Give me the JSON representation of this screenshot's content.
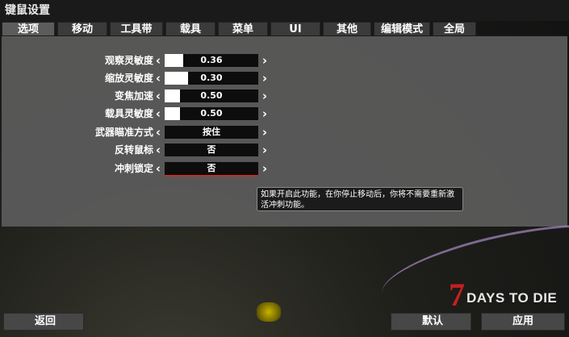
{
  "window": {
    "title": "键鼠设置"
  },
  "tabs": [
    {
      "label": "选项"
    },
    {
      "label": "移动"
    },
    {
      "label": "工具带"
    },
    {
      "label": "载具"
    },
    {
      "label": "菜单"
    },
    {
      "label": "UI"
    },
    {
      "label": "其他"
    },
    {
      "label": "编辑模式"
    },
    {
      "label": "全局"
    }
  ],
  "settings": [
    {
      "label": "观察灵敏度",
      "value": "0.36",
      "fill": 0.2
    },
    {
      "label": "缩放灵敏度",
      "value": "0.30",
      "fill": 0.25
    },
    {
      "label": "变焦加速",
      "value": "0.50",
      "fill": 0.16
    },
    {
      "label": "载具灵敏度",
      "value": "0.50",
      "fill": 0.16
    },
    {
      "label": "武器瞄准方式",
      "value": "按住"
    },
    {
      "label": "反转鼠标",
      "value": "否"
    },
    {
      "label": "冲刺锁定",
      "value": "否"
    }
  ],
  "tooltip": {
    "text": "如果开启此功能，在你停止移动后，你将不需要重新激活冲刺功能。"
  },
  "buttons": {
    "back": "返回",
    "default": "默认",
    "apply": "应用"
  },
  "logo": {
    "seven": "7",
    "text": "DAYS TO DIE"
  },
  "icons": {
    "left": "chevron-left-icon",
    "right": "chevron-right-icon"
  },
  "colors": {
    "panel": "#5c5c5c",
    "field": "#0d0d0d",
    "accent": "#c0302a"
  }
}
